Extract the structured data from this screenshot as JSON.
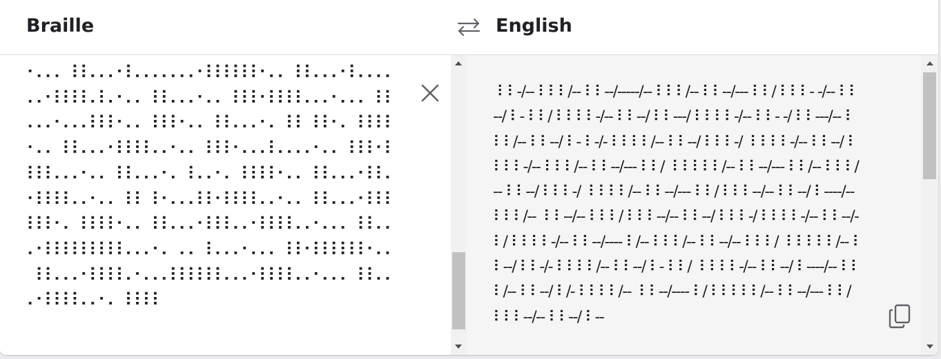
{
  "header": {
    "source_language": "Braille",
    "target_language": "English",
    "swap_icon": "swap-arrows-icon"
  },
  "input": {
    "braille_text": "⠂⠄⠄⠄⠀⠇⠇⠄⠄⠄⠂⠇⠄⠄⠄⠄⠄⠄⠄⠂⠇⠇⠇⠇⠇⠇⠂⠄⠄⠀⠇⠇⠄⠄⠄⠂⠇⠄⠄⠄⠄⠄⠄⠂⠇⠇⠇⠇⠄⠇⠄⠂⠄⠄⠀⠇⠇⠄⠄⠄⠂⠄⠄⠀⠇⠇⠇⠂⠇⠇⠇⠇⠄⠄⠄⠂⠄⠄⠄⠀⠇⠇⠄⠄⠄⠂⠄⠄⠄⠇⠇⠇⠂⠄⠄⠀⠇⠇⠇⠂⠄⠄⠀⠇⠇⠄⠄⠄⠂⠄⠀⠇⠇⠀⠇⠇⠂⠄⠀⠇⠇⠇⠇⠂⠄⠄⠀⠇⠇⠄⠄⠄⠂⠇⠇⠇⠇⠄⠄⠂⠄⠄⠀⠇⠇⠇⠂⠄⠄⠄⠇⠄⠄⠄⠄⠂⠄⠄⠀⠇⠇⠇⠂⠇⠇⠇⠇⠄⠄⠄⠂⠄⠄⠀⠇⠇⠄⠄⠄⠂⠄⠀⠇⠄⠄⠂⠄⠀⠇⠇⠇⠇⠂⠄⠄⠀⠇⠇⠄⠄⠄⠂⠇⠇⠄⠂⠇⠇⠇⠇⠄⠄⠂⠄⠄⠀⠇⠇⠀⠇⠂⠄⠄⠄⠇⠇⠂⠇⠇⠇⠇⠄⠄⠂⠄⠄⠀⠇⠇⠄⠄⠄⠂⠇⠇⠇⠇⠇⠇⠂⠄⠀⠇⠇⠇⠇⠂⠄⠄⠀⠇⠇⠄⠄⠄⠂⠇⠇⠇⠄⠄⠂⠇⠇⠇⠇⠄⠄⠂⠄⠄⠄⠀⠇⠇⠄⠄⠄⠂⠇⠇⠇⠇⠇⠇⠇⠇⠇⠄⠄⠄⠂⠄⠀⠄⠄⠀⠇⠄⠄⠄⠂⠄⠄⠄⠀⠇⠇⠂⠇⠇⠇⠇⠇⠇⠂⠄⠄⠀⠇⠇⠄⠄⠄⠂⠇⠇⠇⠇⠄⠂⠄⠄⠄⠇⠇⠇⠇⠇⠇⠄⠄⠄⠂⠇⠇⠇⠇⠄⠄⠂⠄⠄⠄⠀⠇⠇⠄⠄⠄⠂⠇⠇⠇⠇⠄⠄⠂⠄⠀⠇⠇⠇⠇"
  },
  "output": {
    "english_text": " ⠇⠇-/-- ⠇⠇⠇/-- ⠇⠇--/-----/-- ⠇⠇⠇/-- ⠇⠇--/--- ⠇⠇/ ⠇⠇⠇- -/-- ⠇⠇--/ ⠇- ⠇⠇/ ⠇⠇⠇⠇-/-- ⠇⠇--/ ⠇⠇---/ ⠇⠇⠇⠇-/-- ⠇⠇- -/ ⠇⠇---/-- ⠇⠇⠇/-- ⠇⠇--/ ⠇- ⠇-/- ⠇⠇⠇⠇/-- ⠇⠇--/ ⠇⠇⠇-/  ⠇⠇⠇⠇-/-- ⠇⠇--/ ⠇⠇⠇⠇-/-- ⠇⠇⠇/-- ⠇⠇--/--- ⠇⠇/  ⠇⠇⠇⠇⠇/-- ⠇⠇--/--- ⠇⠇/-- ⠇⠇⠇/-- ⠇⠇--/ ⠇⠇⠇-/  ⠇⠇⠇⠇/-- ⠇⠇--/--- ⠇⠇/ ⠇⠇⠇--/-- ⠇⠇--/ ⠇----/-- ⠇⠇⠇/--  ⠇⠇--/-- ⠇⠇⠇/ ⠇⠇⠇--/-- ⠇⠇--/ ⠇⠇⠇-/ ⠇⠇⠇⠇-/-- ⠇⠇--/-  ⠇/ ⠇⠇⠇⠇-/-- ⠇⠇--/---- ⠇/-- ⠇⠇⠇/-- ⠇⠇--/-- ⠇⠇⠇/  ⠇⠇⠇⠇⠇/-- ⠇⠇--/ ⠇⠇-/- ⠇⠇⠇⠇/-- ⠇⠇--/ ⠇- ⠇⠇/  ⠇⠇⠇⠇-/-- ⠇⠇--/ ⠇----/-- ⠇⠇⠇/-- ⠇⠇--/ ⠇/- ⠇⠇⠇⠇/--  ⠇⠇--/---- ⠇/ ⠇⠇⠇⠇⠇/-- ⠇⠇--/--- ⠇⠇/ ⠇⠇⠇--/-- ⠇⠇--/ ⠇--"
  },
  "icons": {
    "clear": "close-icon",
    "copy": "copy-icon"
  },
  "colors": {
    "icon_gray": "#5f6368",
    "output_background": "#f5f5f5",
    "divider": "#dadce0"
  }
}
